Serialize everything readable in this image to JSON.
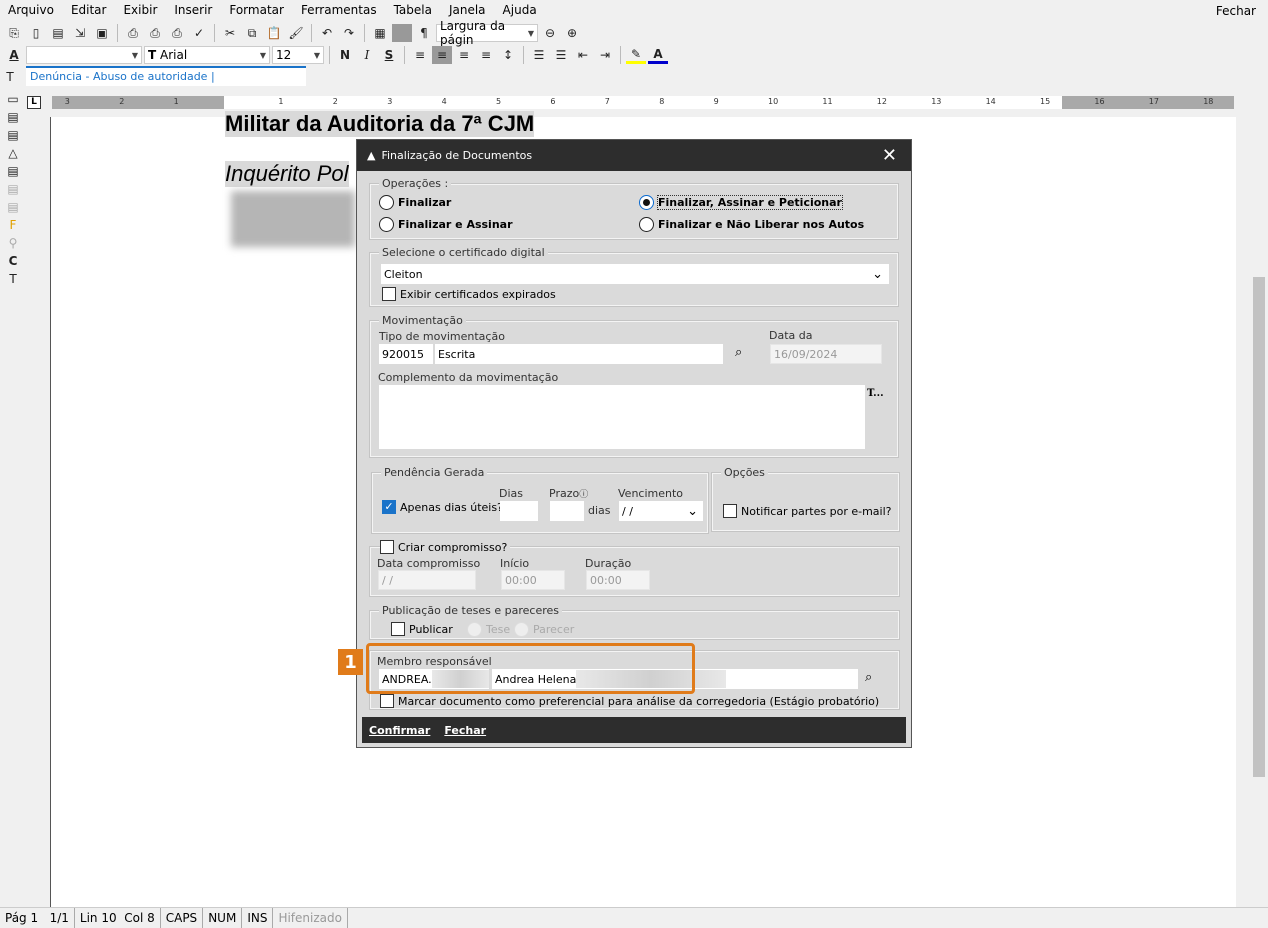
{
  "menu": {
    "items": [
      "Arquivo",
      "Editar",
      "Exibir",
      "Inserir",
      "Formatar",
      "Ferramentas",
      "Tabela",
      "Janela",
      "Ajuda"
    ],
    "close": "Fechar"
  },
  "toolbar": {
    "zoom": "Largura da págin",
    "font": "Arial",
    "size": "12",
    "bold": "N",
    "italic": "I",
    "strike": "S",
    "field_text": "Denúncia - Abuso de autoridade |"
  },
  "ruler": {
    "left": [
      "3",
      "2",
      "1"
    ],
    "right": [
      "1",
      "2",
      "3",
      "4",
      "5",
      "6",
      "7",
      "8",
      "9",
      "10",
      "11",
      "12",
      "13",
      "14",
      "15",
      "16",
      "17",
      "18"
    ]
  },
  "document": {
    "line1": "Militar da Auditoria da 7ª CJM",
    "line2": "Inquérito Pol"
  },
  "dialog": {
    "title": "Finalização de Documentos",
    "operacoes": {
      "label": "Operações :",
      "options": [
        "Finalizar",
        "Finalizar e Assinar",
        "Finalizar, Assinar e Peticionar",
        "Finalizar e Não Liberar nos Autos"
      ],
      "selected": "Finalizar, Assinar e Peticionar"
    },
    "certificado": {
      "label": "Selecione o certificado digital",
      "value": "Cleiton",
      "expired_label": "Exibir certificados expirados",
      "expired_checked": false
    },
    "movimentacao": {
      "label": "Movimentação",
      "tipo_label": "Tipo de movimentação",
      "tipo_code": "920015",
      "tipo_desc": "Escrita",
      "data_label": "Data da movimentação",
      "data": "16/09/2024",
      "complemento_label": "Complemento da movimentação",
      "complemento": "",
      "t_button": "T..."
    },
    "pendencia": {
      "label": "Pendência Gerada",
      "uteis_label": "Apenas dias úteis?",
      "uteis_checked": true,
      "dias_label": "Dias",
      "prazo_label": "Prazo",
      "dias_suffix": "dias",
      "vencimento_label": "Vencimento",
      "vencimento": " /  /"
    },
    "opcoes": {
      "label": "Opções",
      "notificar_label": "Notificar partes por e-mail?",
      "notificar_checked": false
    },
    "compromisso": {
      "label": "Criar compromisso?",
      "checked": false,
      "data_label": "Data compromisso",
      "data": " /  /",
      "inicio_label": "Início",
      "inicio": "00:00",
      "duracao_label": "Duração",
      "duracao": "00:00"
    },
    "publicacao": {
      "label": "Publicação de teses e pareceres",
      "publicar": "Publicar",
      "tese": "Tese",
      "parecer": "Parecer"
    },
    "membro": {
      "label": "Membro responsável",
      "login": "ANDREA.",
      "name": "Andrea Helena"
    },
    "preferencial": "Marcar documento como preferencial para análise da corregedoria (Estágio probatório)",
    "confirm": "Confirmar",
    "close": "Fechar"
  },
  "annotation": {
    "number": "1",
    "color": "#e07b1a"
  },
  "status": {
    "page": "Pág 1",
    "pages": "1/1",
    "pos": "Lin 10  Col 8",
    "caps": "CAPS",
    "num": "NUM",
    "ins": "INS",
    "hyphen": "Hifenizado"
  }
}
